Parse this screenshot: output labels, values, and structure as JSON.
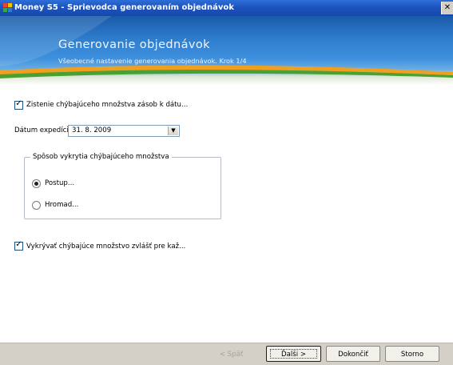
{
  "window": {
    "title": "Money S5 - Sprievodca generovaním objednávok",
    "close_label": "✕"
  },
  "banner": {
    "heading": "Generovanie objednávok",
    "subheading": "Všeobecné nastavenie generovania objednávok. Krok 1/4"
  },
  "form": {
    "check_missing_label": "Zistenie chýbajúceho množstva zásob k dátu...",
    "check_missing_checked": true,
    "date_label": "Dátum expedície",
    "date_value": "31. 8. 2009",
    "group_title": "Spôsob vykrytia chýbajúceho množstva",
    "radio_options": [
      {
        "label": "Postup...",
        "selected": true
      },
      {
        "label": "Hromad...",
        "selected": false
      }
    ],
    "cover_separately_label": "Vykrývať chýbajúce množstvo zvlášť pre kaž...",
    "cover_separately_checked": true
  },
  "footer": {
    "back_label": "< Späť",
    "next_label": "Ďalši >",
    "finish_label": "Dokončiť",
    "cancel_label": "Storno"
  },
  "colors": {
    "titlebar": "#1e54bd",
    "banner_dark": "#1a5aa8",
    "banner_light": "#6aaee4",
    "swoosh_orange": "#f0a020",
    "swoosh_green": "#4aa030",
    "footer": "#d4d0c8"
  }
}
